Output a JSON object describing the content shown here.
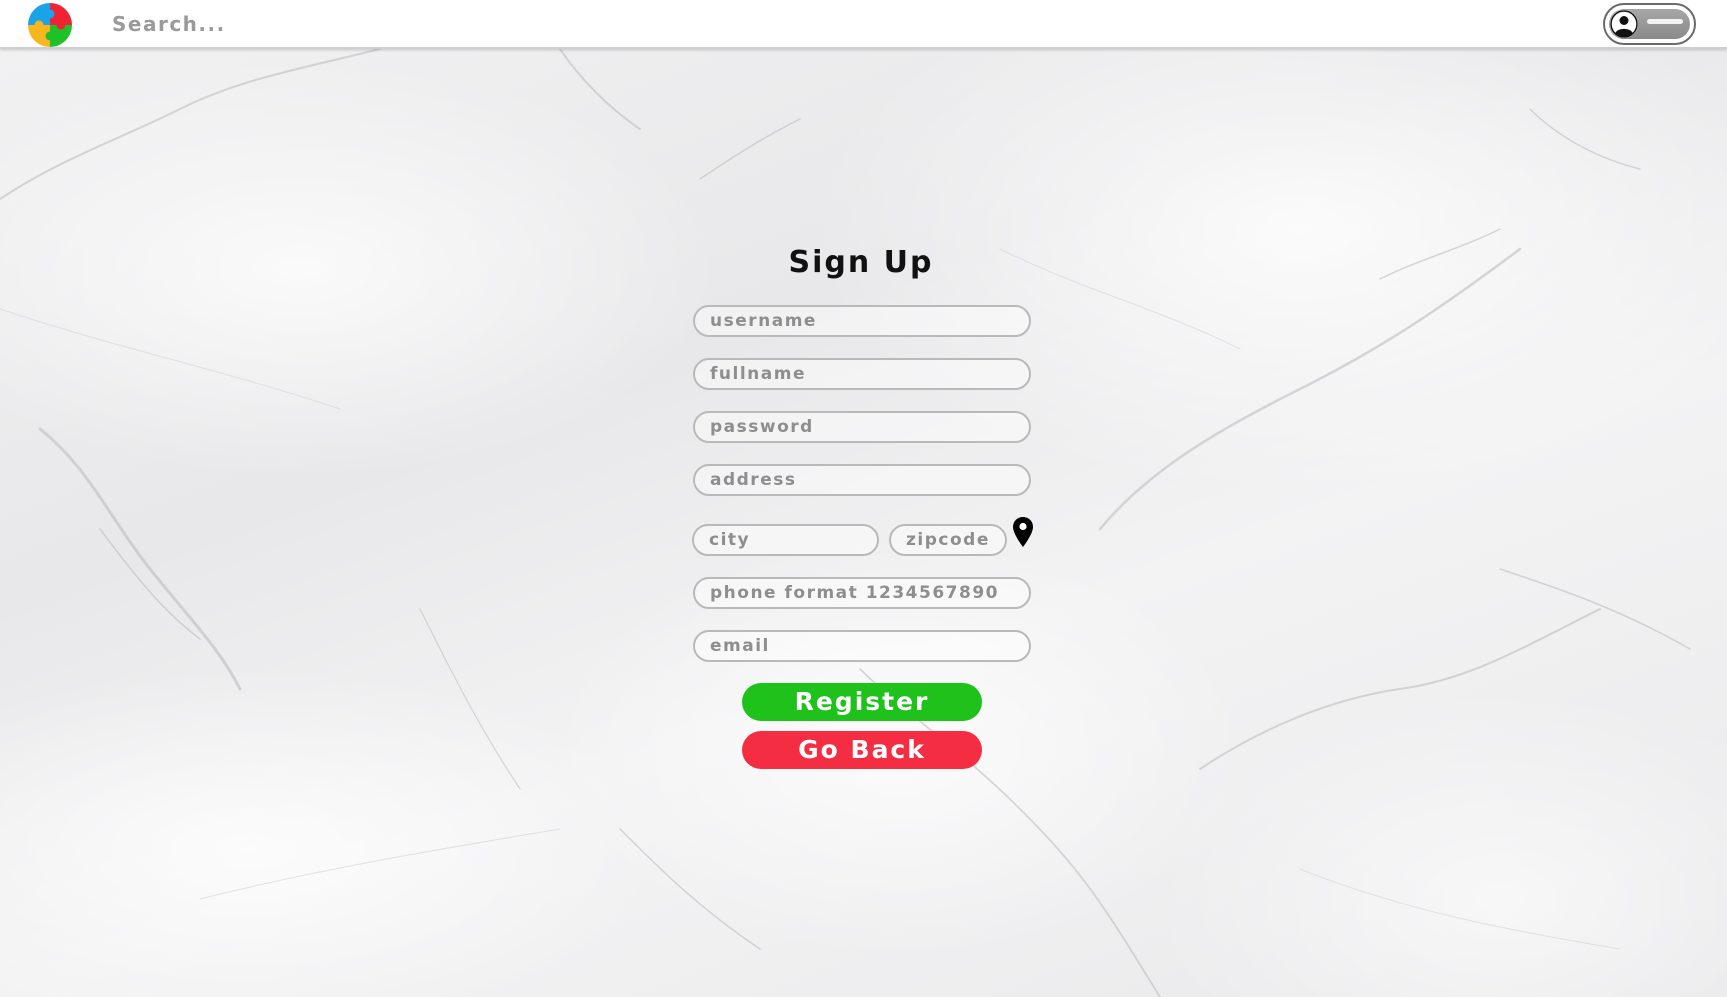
{
  "header": {
    "search_placeholder": "Search...",
    "logo_icon": "puzzle-logo-icon",
    "account_icon": "user-toggle-icon"
  },
  "form": {
    "title": "Sign Up",
    "fields": {
      "username_placeholder": "username",
      "fullname_placeholder": "fullname",
      "password_placeholder": "password",
      "address_placeholder": "address",
      "city_placeholder": "city",
      "zipcode_placeholder": "zipcode",
      "phone_placeholder": "phone format 1234567890",
      "email_placeholder": "email"
    },
    "location_icon": "map-pin-icon",
    "register_label": "Register",
    "go_back_label": "Go Back"
  },
  "colors": {
    "register": "#1ec21a",
    "go_back": "#f52d43",
    "logo_blue": "#1aa3e8",
    "logo_red": "#ee2436",
    "logo_green": "#1fc02a",
    "logo_yellow": "#f7b51e"
  }
}
